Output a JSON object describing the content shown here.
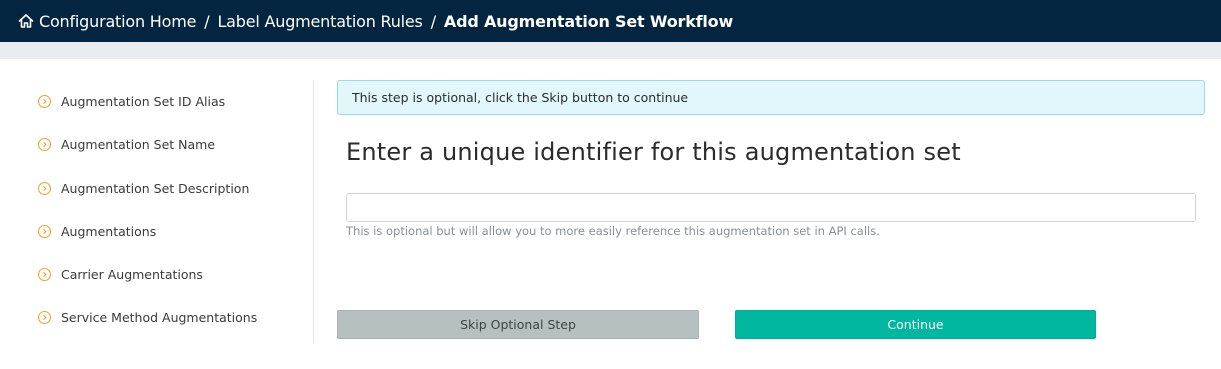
{
  "header": {
    "crumbs": [
      "Configuration Home",
      "Label Augmentation Rules",
      "Add Augmentation Set Workflow"
    ],
    "separator": "/"
  },
  "sidebar": {
    "steps": [
      {
        "label": "Augmentation Set ID Alias",
        "icon": "chevron-right-circle-icon"
      },
      {
        "label": "Augmentation Set Name",
        "icon": "chevron-right-circle-icon"
      },
      {
        "label": "Augmentation Set Description",
        "icon": "chevron-right-circle-icon"
      },
      {
        "label": "Augmentations",
        "icon": "chevron-right-circle-icon"
      },
      {
        "label": "Carrier Augmentations",
        "icon": "chevron-right-circle-icon"
      },
      {
        "label": "Service Method Augmentations",
        "icon": "chevron-right-circle-icon"
      }
    ]
  },
  "main": {
    "alert": "This step is optional, click the Skip button to continue",
    "heading": "Enter a unique identifier for this augmentation set",
    "input_value": "",
    "hint": "This is optional but will allow you to more easily reference this augmentation set in API calls.",
    "skip_label": "Skip Optional Step",
    "continue_label": "Continue"
  },
  "colors": {
    "header_bg": "#03253f",
    "accent_orange": "#f0a020",
    "continue_bg": "#00b8a0",
    "skip_bg": "#b7c0c1",
    "alert_bg": "#e2f7fc"
  }
}
